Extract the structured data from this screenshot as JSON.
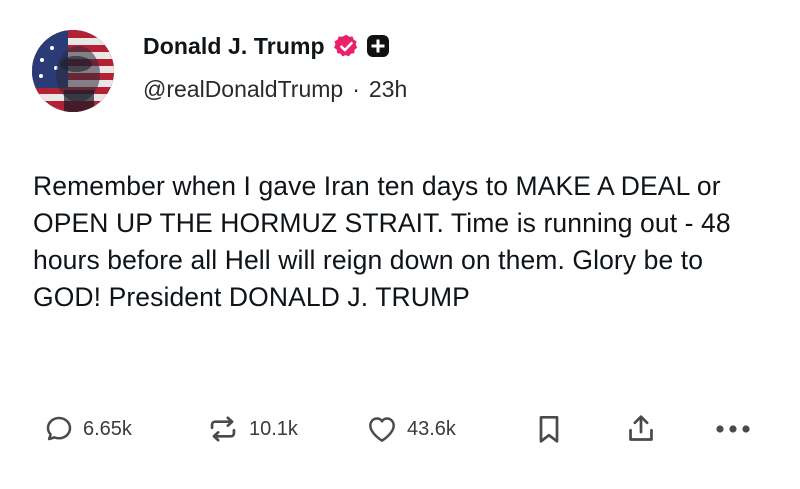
{
  "post": {
    "author": {
      "display_name": "Donald J. Trump",
      "handle": "@realDonaldTrump",
      "separator": "·",
      "timestamp": "23h",
      "verified_badge_color": "#e8216b"
    },
    "body": "Remember when I gave Iran ten days to MAKE A DEAL or OPEN UP THE HORMUZ STRAIT. Time is running out - 48 hours before all Hell will reign down on them. Glory be to GOD! President DONALD J. TRUMP",
    "actions": {
      "replies": {
        "icon": "reply-bubble-icon",
        "count": "6.65k"
      },
      "reposts": {
        "icon": "repost-icon",
        "count": "10.1k"
      },
      "likes": {
        "icon": "heart-icon",
        "count": "43.6k"
      },
      "bookmark": {
        "icon": "bookmark-icon"
      },
      "share": {
        "icon": "share-icon"
      },
      "more": {
        "icon": "more-dots-icon"
      }
    }
  }
}
